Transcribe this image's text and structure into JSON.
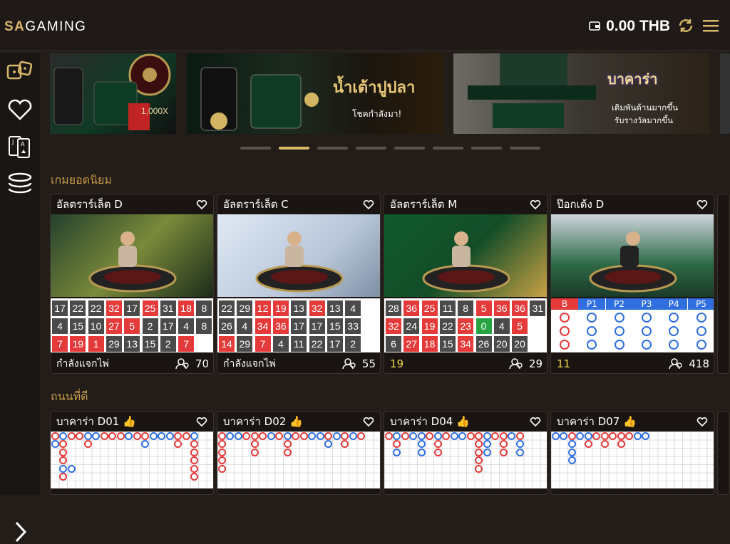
{
  "header": {
    "logo_sa": "SA",
    "logo_gaming": "GAMING",
    "balance": "0.00 THB"
  },
  "sidebar": {
    "items": [
      "dice-icon",
      "heart-icon",
      "cards-icon",
      "chips-icon"
    ]
  },
  "banners": [
    {
      "text": "1,000X"
    },
    {
      "title": "น้ำเต้าปูปลา",
      "subtitle": "โชคกำลังมา!"
    },
    {
      "title": "บาคาร่า",
      "line1": "เดิมพันด้านมากขึ้น",
      "line2": "รับรางวัลมากขึ้น"
    }
  ],
  "carousel": {
    "count": 8,
    "active": 1
  },
  "sections": {
    "popular": "เกมยอดนิยม",
    "good_roads": "ถนนที่ดี"
  },
  "popular_cards": [
    {
      "title": "อัลตราร์เล็ต D",
      "status": "กำลังแจกไพ่",
      "players": "70",
      "rows": [
        [
          "17",
          "22",
          "22",
          "32",
          "17",
          "25",
          "31",
          "18",
          "8"
        ],
        [
          "4",
          "15",
          "10",
          "27",
          "5",
          "2",
          "17",
          "4",
          "8"
        ],
        [
          "7",
          "19",
          "1",
          "29",
          "13",
          "15",
          "2",
          "7",
          ""
        ]
      ],
      "colors": [
        [
          "b",
          "b",
          "b",
          "r",
          "b",
          "r",
          "b",
          "r",
          "b"
        ],
        [
          "b",
          "b",
          "b",
          "r",
          "r",
          "b",
          "b",
          "b",
          "b"
        ],
        [
          "r",
          "r",
          "r",
          "b",
          "b",
          "b",
          "b",
          "r",
          "w"
        ]
      ]
    },
    {
      "title": "อัลตราร์เล็ต C",
      "status": "กำลังแจกไพ่",
      "players": "55",
      "rows": [
        [
          "22",
          "29",
          "12",
          "19",
          "13",
          "32",
          "13",
          "4",
          ""
        ],
        [
          "26",
          "4",
          "34",
          "36",
          "17",
          "17",
          "15",
          "33",
          ""
        ],
        [
          "14",
          "29",
          "7",
          "4",
          "11",
          "22",
          "17",
          "2",
          ""
        ]
      ],
      "colors": [
        [
          "b",
          "b",
          "r",
          "r",
          "b",
          "r",
          "b",
          "b",
          "w"
        ],
        [
          "b",
          "b",
          "r",
          "r",
          "b",
          "b",
          "b",
          "b",
          "w"
        ],
        [
          "r",
          "b",
          "r",
          "b",
          "b",
          "b",
          "b",
          "b",
          "w"
        ]
      ]
    },
    {
      "title": "อัลตราร์เล็ต M",
      "status": "19",
      "players": "29",
      "rows": [
        [
          "28",
          "36",
          "25",
          "11",
          "8",
          "5",
          "36",
          "36",
          "31"
        ],
        [
          "32",
          "24",
          "19",
          "22",
          "23",
          "0",
          "4",
          "5",
          ""
        ],
        [
          "6",
          "27",
          "18",
          "15",
          "34",
          "26",
          "20",
          "20",
          ""
        ]
      ],
      "colors": [
        [
          "b",
          "r",
          "r",
          "b",
          "b",
          "r",
          "r",
          "r",
          "b"
        ],
        [
          "r",
          "b",
          "r",
          "b",
          "r",
          "g",
          "b",
          "r",
          "w"
        ],
        [
          "b",
          "r",
          "r",
          "b",
          "r",
          "b",
          "b",
          "b",
          "w"
        ]
      ]
    },
    {
      "title": "ป๊อกเด้ง D",
      "status": "11",
      "players": "418",
      "headers": [
        "B",
        "P1",
        "P2",
        "P3",
        "P4",
        "P5"
      ]
    }
  ],
  "road_cards": [
    {
      "title": "บาคาร่า D01"
    },
    {
      "title": "บาคาร่า D02"
    },
    {
      "title": "บาคาร่า D04"
    },
    {
      "title": "บาคาร่า D07"
    }
  ],
  "colors": {
    "accent": "#d9b86a",
    "section": "#c79b4a",
    "red": "#e43a3a",
    "blue": "#2f6fe0"
  }
}
